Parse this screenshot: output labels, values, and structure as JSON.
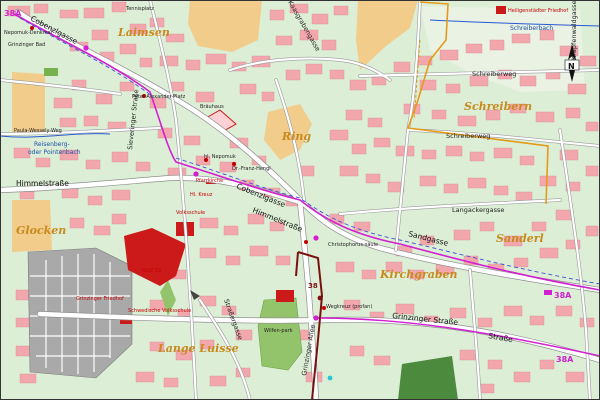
{
  "map": {
    "colors": {
      "land": "#dcefd6",
      "buildings": "#f2a7ad",
      "roads": "#ffffff",
      "road_edge": "#9a9a9a",
      "sand": "#f2cc8a",
      "tram_line": "#7a1010",
      "bus_line": "#d21fd2",
      "district_border": "#e59a1a",
      "water": "#2a5ad1",
      "cemetery": "#a9a9a9",
      "park": "#93c46b",
      "forest": "#4c8a3e"
    },
    "district_names": [
      "Laimsen",
      "Schreibern",
      "Ring",
      "Glocken",
      "Sanderl",
      "Kirchgraben",
      "Lange Luisse"
    ],
    "streets": {
      "cobenzlgasse": "Cobenzlgasse",
      "cobenzlgasse2": "Cobenzlgasse",
      "himmelstrasse": "Himmelstraße",
      "himmelstrasse2": "Himmelstraße",
      "sandgasse": "Sandgasse",
      "grinzinger_strasse": "Grinzinger Straße",
      "strasse": "Straße",
      "schreiberweg": "Schreiberweg",
      "schreiberweg2": "Schreiberweg",
      "langackergasse": "Langackergasse",
      "strassergasse": "Straßergasse",
      "kaasgrabengasse": "Kaasgrabengasse",
      "krapfenwaldgasse": "Krapfenwaldgasse",
      "grinzinger_allee": "Grinzinger Allee",
      "sieveringer": "Sieveringer Straße"
    },
    "pois": {
      "tennisplatz": "Tennisplatz",
      "nepomuk_denkmal": "Nepomuk-Denkmal",
      "grinzinger_bad": "Grinzinger Bad",
      "peter_alexander": "Peter-Alexander-Platz",
      "brauhaus": "Bräuhaus",
      "nepomuk": "hl. Nepomuk",
      "franz_hengl": "Dr.-Franz-Hengl",
      "pfarrkirche": "Pfarrkirche",
      "hk_kreuz": "Hl. Kreuz",
      "volksschule": "Volksschule",
      "hlw19": "HLW 19",
      "friedhof": "Grinzinger Friedhof",
      "schwedische": "Schwedische Volksschule",
      "christophorus": "Christophorus-säule",
      "wegkreuz": "Wegkreuz (profan)",
      "wilfeen": "Wilfen-park",
      "heiligenstaedter_friedhof": "Heiligenstädter Friedhof",
      "paula_wessely_weg": "Paula-Wessely-Weg"
    },
    "waters": {
      "reisenberg": "Reisenberg-",
      "reisenberg2": "oder Pointenbach",
      "schreiberbach": "Schreiberbach"
    },
    "routes": {
      "bus_a": "38A",
      "bus_b": "38A",
      "bus_c": "38A",
      "tram": "38"
    },
    "compass": "N"
  }
}
